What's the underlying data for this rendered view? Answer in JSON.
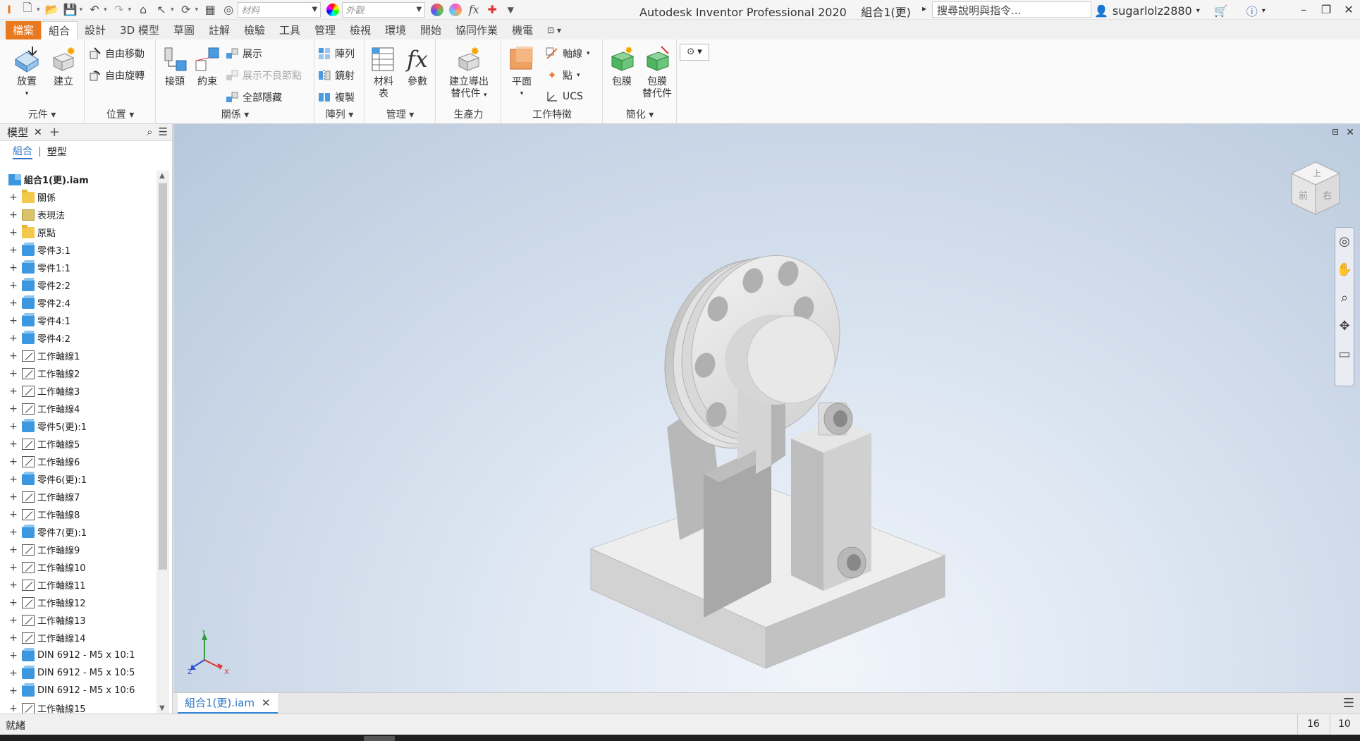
{
  "titlebar": {
    "app_title": "Autodesk Inventor Professional 2020",
    "doc_title": "組合1(更)",
    "material_placeholder": "材料",
    "appearance_placeholder": "外觀",
    "search_placeholder": "搜尋說明與指令...",
    "username": "sugarlolz2880"
  },
  "menu": {
    "file": "檔案",
    "tabs": [
      "組合",
      "設計",
      "3D 模型",
      "草圖",
      "註解",
      "檢驗",
      "工具",
      "管理",
      "檢視",
      "環境",
      "開始",
      "協同作業",
      "機電"
    ]
  },
  "ribbon": {
    "component": {
      "title": "元件",
      "place": "放置",
      "create": "建立"
    },
    "position": {
      "title": "位置",
      "free_move": "自由移動",
      "free_rotate": "自由旋轉"
    },
    "relationships": {
      "title": "關係",
      "joint": "接頭",
      "constrain": "約束",
      "show": "展示",
      "show_sick": "展示不良節點",
      "hide_all": "全部隱藏"
    },
    "pattern": {
      "title": "陣列",
      "pattern": "陣列",
      "mirror": "鏡射",
      "copy": "複製"
    },
    "manage": {
      "title": "管理",
      "bom_line1": "材料",
      "bom_line2": "表",
      "parameters": "參數"
    },
    "productivity": {
      "title": "生產力",
      "line1": "建立導出",
      "line2": "替代件"
    },
    "work_features": {
      "title": "工作特徵",
      "plane": "平面",
      "axis": "軸線",
      "point": "點",
      "ucs": "UCS"
    },
    "simplification": {
      "title": "簡化",
      "shrinkwrap": "包膜",
      "sub_line1": "包膜",
      "sub_line2": "替代件"
    }
  },
  "browser": {
    "title": "模型",
    "tab_assembly": "組合",
    "tab_modeling": "塑型",
    "root": "組合1(更).iam",
    "nodes": [
      {
        "label": "關係",
        "icon": "folder"
      },
      {
        "label": "表現法",
        "icon": "representations"
      },
      {
        "label": "原點",
        "icon": "folder"
      },
      {
        "label": "零件3:1",
        "icon": "part-grounded"
      },
      {
        "label": "零件1:1",
        "icon": "part"
      },
      {
        "label": "零件2:2",
        "icon": "part"
      },
      {
        "label": "零件2:4",
        "icon": "part"
      },
      {
        "label": "零件4:1",
        "icon": "part"
      },
      {
        "label": "零件4:2",
        "icon": "part"
      },
      {
        "label": "工作軸線1",
        "icon": "axis"
      },
      {
        "label": "工作軸線2",
        "icon": "axis"
      },
      {
        "label": "工作軸線3",
        "icon": "axis"
      },
      {
        "label": "工作軸線4",
        "icon": "axis"
      },
      {
        "label": "零件5(更):1",
        "icon": "part"
      },
      {
        "label": "工作軸線5",
        "icon": "axis"
      },
      {
        "label": "工作軸線6",
        "icon": "axis"
      },
      {
        "label": "零件6(更):1",
        "icon": "part"
      },
      {
        "label": "工作軸線7",
        "icon": "axis"
      },
      {
        "label": "工作軸線8",
        "icon": "axis"
      },
      {
        "label": "零件7(更):1",
        "icon": "part"
      },
      {
        "label": "工作軸線9",
        "icon": "axis"
      },
      {
        "label": "工作軸線10",
        "icon": "axis"
      },
      {
        "label": "工作軸線11",
        "icon": "axis"
      },
      {
        "label": "工作軸線12",
        "icon": "axis"
      },
      {
        "label": "工作軸線13",
        "icon": "axis"
      },
      {
        "label": "工作軸線14",
        "icon": "axis"
      },
      {
        "label": "DIN 6912 - M5 x 10:1",
        "icon": "part"
      },
      {
        "label": "DIN 6912 - M5 x 10:5",
        "icon": "part"
      },
      {
        "label": "DIN 6912 - M5 x 10:6",
        "icon": "part"
      },
      {
        "label": "工作軸線15",
        "icon": "axis"
      }
    ]
  },
  "viewport": {
    "viewcube_top": "上",
    "viewcube_front": "前",
    "viewcube_right": "右",
    "triad_x": "X",
    "triad_y": "Y",
    "triad_z": "Z"
  },
  "doctab": {
    "label": "組合1(更).iam"
  },
  "status": {
    "text": "就緒",
    "num1": "16",
    "num2": "10"
  },
  "colors": {
    "file_tab": "#e8791e",
    "accent": "#2f86d6",
    "part_icon": "#3b97e0"
  }
}
